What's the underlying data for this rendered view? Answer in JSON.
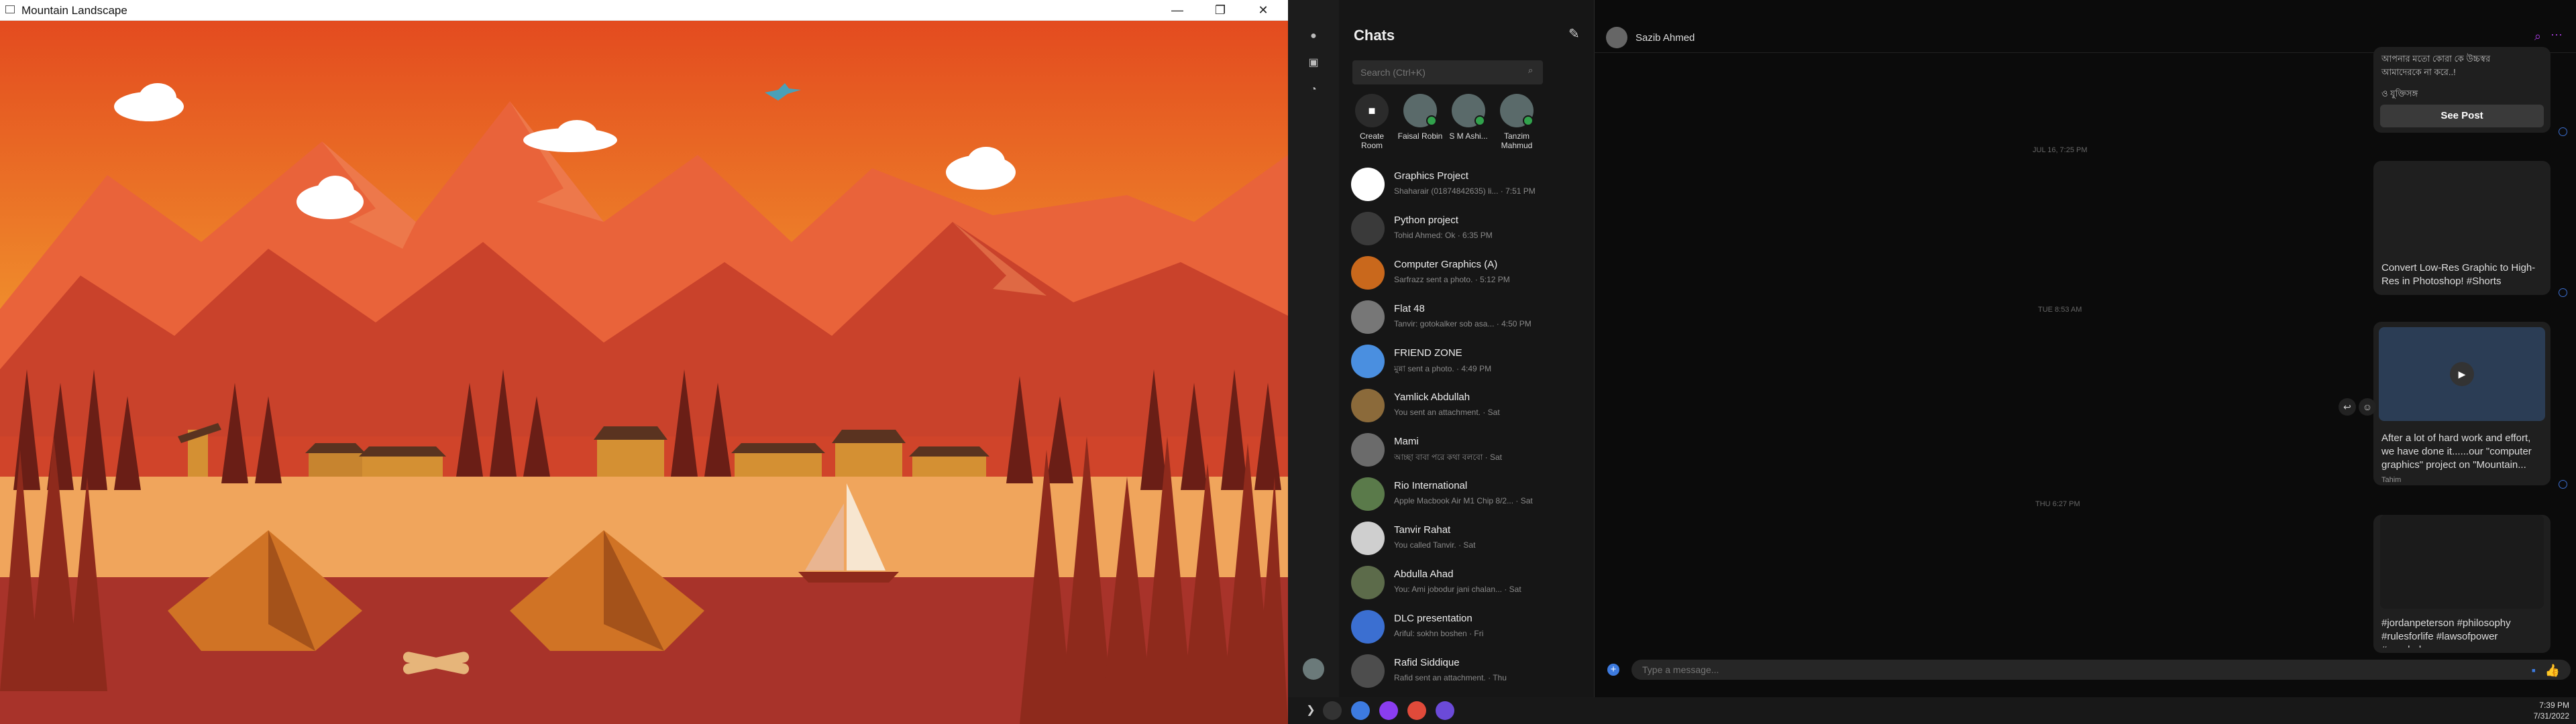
{
  "left_window": {
    "title": "Mountain Landscape",
    "controls": {
      "minimize": "—",
      "maximize": "❐",
      "close": "✕"
    }
  },
  "messenger": {
    "chats_title": "Chats",
    "search_placeholder": "Search (Ctrl+K)",
    "stories": [
      {
        "name": "Create Room",
        "online": false
      },
      {
        "name": "Faisal Robin",
        "online": true
      },
      {
        "name": "S M Ashi...",
        "online": true
      },
      {
        "name": "Tanzim Mahmud",
        "online": true
      }
    ],
    "chats": [
      {
        "name": "Graphics Project",
        "preview": "Shaharair (01874842635) li... · 7:51 PM",
        "color": "#ffffff"
      },
      {
        "name": "Python project",
        "preview": "Tohid Ahmed: Ok · 6:35 PM",
        "color": "#3a3a3a"
      },
      {
        "name": "Computer Graphics (A)",
        "preview": "Sarfrazz sent a photo. · 5:12 PM",
        "color": "#c9681c"
      },
      {
        "name": "Flat 48",
        "preview": "Tanvir: gotokalker sob asa... · 4:50 PM",
        "color": "#777777"
      },
      {
        "name": "FRIEND ZONE",
        "preview": "মুন্না sent a photo. · 4:49 PM",
        "color": "#4a8fe0"
      },
      {
        "name": "Yamlick Abdullah",
        "preview": "You sent an attachment. · Sat",
        "color": "#8b6a3a"
      },
      {
        "name": "Mami",
        "preview": "আচ্ছা বাবা পরে কথা বলবো · Sat",
        "color": "#6b6b6b"
      },
      {
        "name": "Rio International",
        "preview": "Apple Macbook Air M1 Chip 8/2... · Sat",
        "color": "#5a7a4a"
      },
      {
        "name": "Tanvir Rahat",
        "preview": "You called Tanvir. · Sat",
        "color": "#cfcfcf"
      },
      {
        "name": "Abdulla Ahad",
        "preview": "You: Ami jobodur jani chalan... · Sat",
        "color": "#5c6b4a"
      },
      {
        "name": "DLC presentation",
        "preview": "Ariful: sokhn boshen · Fri",
        "color": "#3b6fd1"
      },
      {
        "name": "Rafid Siddique",
        "preview": "Rafid sent an attachment. · Thu",
        "color": "#4d4d4d"
      }
    ],
    "conversation": {
      "name": "Sazib Ahmed",
      "timestamps": [
        "JUL 16, 7:25 PM",
        "TUE 8:53 AM",
        "THU 6:27 PM"
      ],
      "card1_text": "আপনার মতো কোরা কে উচ্চস্বর\nআমাদেরকে না করে..!",
      "card1_text2": "ও যুক্তিসঙ্গ",
      "see_post": "See Post",
      "card2_text": "Convert Low-Res Graphic to High-Res in Photoshop! #Shorts",
      "card3_text": "After a lot of hard work and effort, we have done it......our \"computer graphics\" project on \"Mountain...",
      "card3_sub": "Tahim",
      "card4_text": "#jordanpeterson #philosophy #rulesforlife #lawsofpower #psychology",
      "composer_placeholder": "Type a message..."
    }
  },
  "taskbar": {
    "time": "7:39 PM",
    "date": "7/31/2022"
  }
}
